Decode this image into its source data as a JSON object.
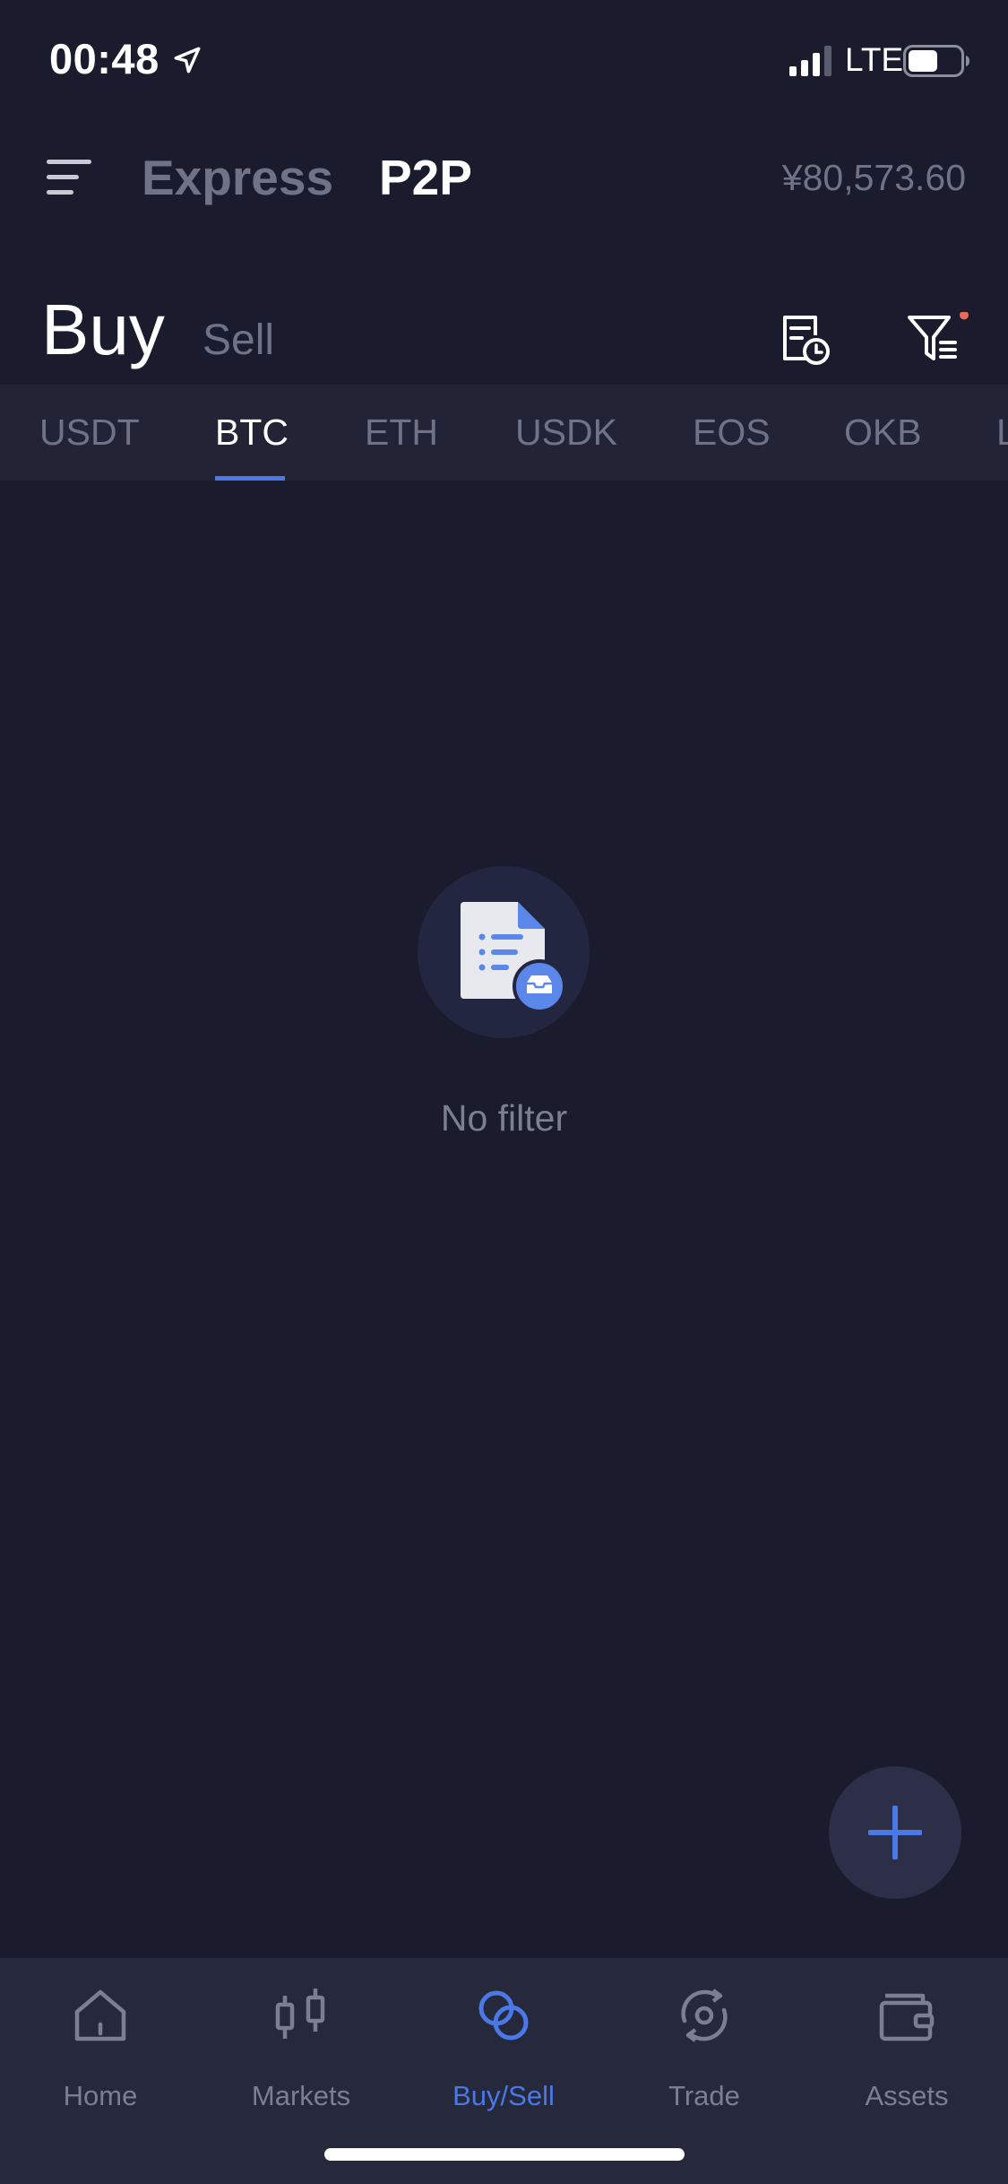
{
  "status_bar": {
    "time": "00:48",
    "network": "LTE",
    "icons": [
      "location-arrow-icon",
      "signal-bars-icon",
      "battery-icon"
    ]
  },
  "top_nav": {
    "menu_icon": "hamburger-menu-icon",
    "tabs": [
      {
        "label": "Express",
        "active": false
      },
      {
        "label": "P2P",
        "active": true
      }
    ],
    "balance": "¥80,573.60"
  },
  "trade_side": {
    "buy_label": "Buy",
    "sell_label": "Sell",
    "active": "Buy",
    "orders_icon": "order-history-icon",
    "filter_icon": "filter-icon",
    "filter_badge_color": "#e86a5c"
  },
  "coin_tabs": {
    "items": [
      "USDT",
      "BTC",
      "ETH",
      "USDK",
      "EOS",
      "OKB",
      "L"
    ],
    "active": "BTC",
    "accent_color": "#4a78e6"
  },
  "empty_state": {
    "icon": "empty-document-icon",
    "message": "No filter"
  },
  "fab": {
    "icon": "plus-icon"
  },
  "bottom_nav": {
    "items": [
      {
        "label": "Home",
        "icon": "home-icon",
        "active": false
      },
      {
        "label": "Markets",
        "icon": "candlestick-icon",
        "active": false
      },
      {
        "label": "Buy/Sell",
        "icon": "buy-sell-icon",
        "active": true
      },
      {
        "label": "Trade",
        "icon": "trade-cycle-icon",
        "active": false
      },
      {
        "label": "Assets",
        "icon": "wallet-icon",
        "active": false
      }
    ]
  }
}
